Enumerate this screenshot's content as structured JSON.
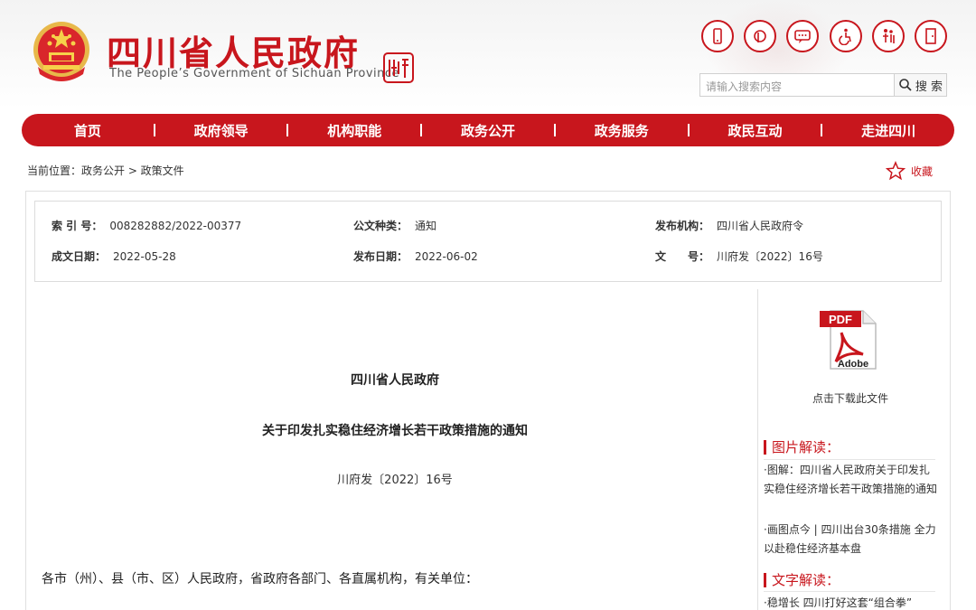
{
  "header": {
    "title": "四川省人民政府",
    "subtitle": "The People’s Government of Sichuan Province",
    "seal_text": "四川印象"
  },
  "utility_icons": [
    "phone-icon",
    "weibo-icon",
    "message-icon",
    "accessibility-icon",
    "elderly-care-icon",
    "exit-icon"
  ],
  "search": {
    "placeholder": "请输入搜索内容",
    "button_label": "搜 索"
  },
  "nav": {
    "items": [
      "首页",
      "政府领导",
      "机构职能",
      "政务公开",
      "政务服务",
      "政民互动",
      "走进四川"
    ]
  },
  "breadcrumb": "当前位置：政务公开 > 政策文件",
  "favorite_label": "收藏",
  "meta": {
    "index_label": "索 引 号：",
    "index_value": "008282882/2022-00377",
    "type_label": "公文种类：",
    "type_value": "通知",
    "issuer_label": "发布机构：",
    "issuer_value": "四川省人民政府令",
    "created_label": "成文日期：",
    "created_value": "2022-05-28",
    "published_label": "发布日期：",
    "published_value": "2022-06-02",
    "doc_no_label": "文　　号：",
    "doc_no_value": "川府发〔2022〕16号"
  },
  "document": {
    "org": "四川省人民政府",
    "title": "关于印发扎实稳住经济增长若干政策措施的通知",
    "number": "川府发〔2022〕16号",
    "addressee": "各市（州）、县（市、区）人民政府，省政府各部门、各直属机构，有关单位："
  },
  "sidebar": {
    "pdf_badge": "PDF",
    "pdf_brand": "Adobe",
    "download_label": "点击下载此文件",
    "image_section_title": "图片解读：",
    "image_links": [
      "·图解：四川省人民政府关于印发扎实稳住经济增长若干政策措施的通知",
      "·画图点今 | 四川出台30条措施 全力以赴稳住经济基本盘"
    ],
    "text_section_title": "文字解读：",
    "text_links": [
      "·稳增长 四川打好这套“组合拳”"
    ]
  },
  "colors": {
    "brand_red": "#c8161d"
  }
}
